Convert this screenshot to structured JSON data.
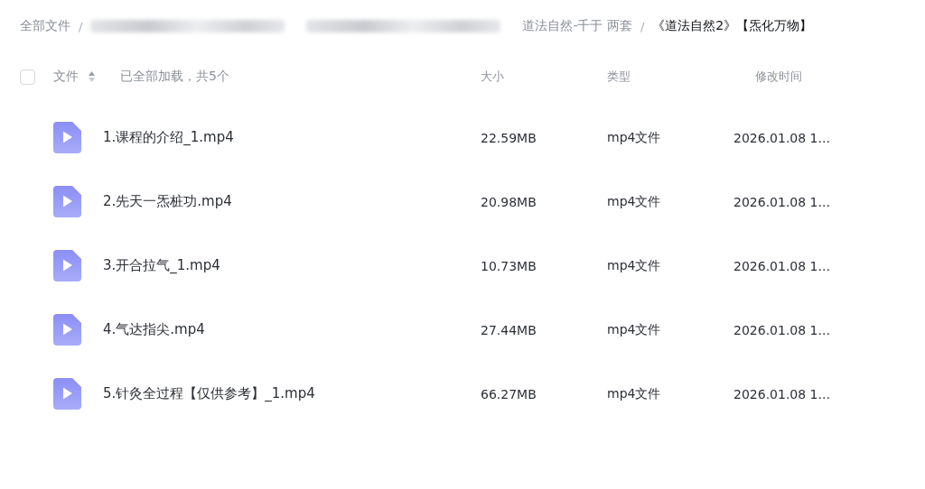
{
  "breadcrumb": [
    {
      "kind": "text",
      "label": "全部文件",
      "selected": false
    },
    {
      "kind": "separator",
      "label": "/"
    },
    {
      "kind": "redacted"
    },
    {
      "kind": "redacted"
    },
    {
      "kind": "text",
      "label": "道法自然-千于 两套",
      "selected": false
    },
    {
      "kind": "separator",
      "label": "/"
    },
    {
      "kind": "text",
      "label": "《道法自然2》【炁化万物】",
      "selected": true
    }
  ],
  "header": {
    "select_all": {
      "checked": false
    },
    "name_label": "文件",
    "status": "已全部加载，共5个",
    "columns": [
      "大小",
      "类型",
      "修改时间"
    ]
  },
  "rows": [
    {
      "name": "1.课程的介绍_1.mp4",
      "size": "22.59MB",
      "type": "mp4文件",
      "modified": "2026.01.08 1..."
    },
    {
      "name": "2.先天一炁桩功.mp4",
      "size": "20.98MB",
      "type": "mp4文件",
      "modified": "2026.01.08 1..."
    },
    {
      "name": "3.开合拉气_1.mp4",
      "size": "10.73MB",
      "type": "mp4文件",
      "modified": "2026.01.08 1..."
    },
    {
      "name": "4.气达指尖.mp4",
      "size": "27.44MB",
      "type": "mp4文件",
      "modified": "2026.01.08 1..."
    },
    {
      "name": "5.针灸全过程【仅供参考】_1.mp4",
      "size": "66.27MB",
      "type": "mp4文件",
      "modified": "2026.01.08 1..."
    }
  ]
}
